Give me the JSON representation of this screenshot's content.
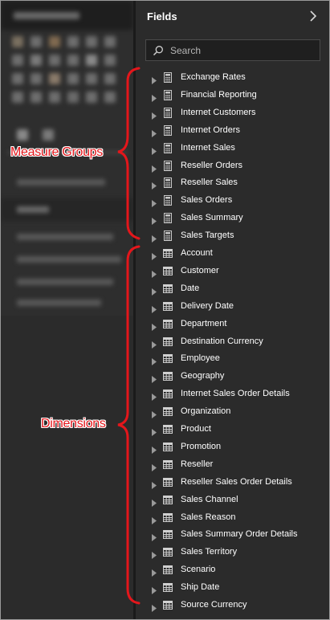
{
  "fields_pane": {
    "title": "Fields",
    "search_placeholder": "Search"
  },
  "measure_groups": [
    "Exchange Rates",
    "Financial Reporting",
    "Internet Customers",
    "Internet Orders",
    "Internet Sales",
    "Reseller Orders",
    "Reseller Sales",
    "Sales Orders",
    "Sales Summary",
    "Sales Targets"
  ],
  "dimensions": [
    "Account",
    "Customer",
    "Date",
    "Delivery Date",
    "Department",
    "Destination Currency",
    "Employee",
    "Geography",
    "Internet Sales Order Details",
    "Organization",
    "Product",
    "Promotion",
    "Reseller",
    "Reseller Sales Order Details",
    "Sales Channel",
    "Sales Reason",
    "Sales Summary Order Details",
    "Sales Territory",
    "Scenario",
    "Ship Date",
    "Source Currency"
  ],
  "annotations": {
    "measure_groups_label": "Measure Groups",
    "dimensions_label": "Dimensions",
    "color": "#e4161b"
  },
  "icons": {
    "measure_group": "calculator-icon",
    "dimension": "table-icon",
    "expand": "caret-right-icon",
    "collapse_pane": "chevron-right-icon",
    "search": "search-icon"
  }
}
